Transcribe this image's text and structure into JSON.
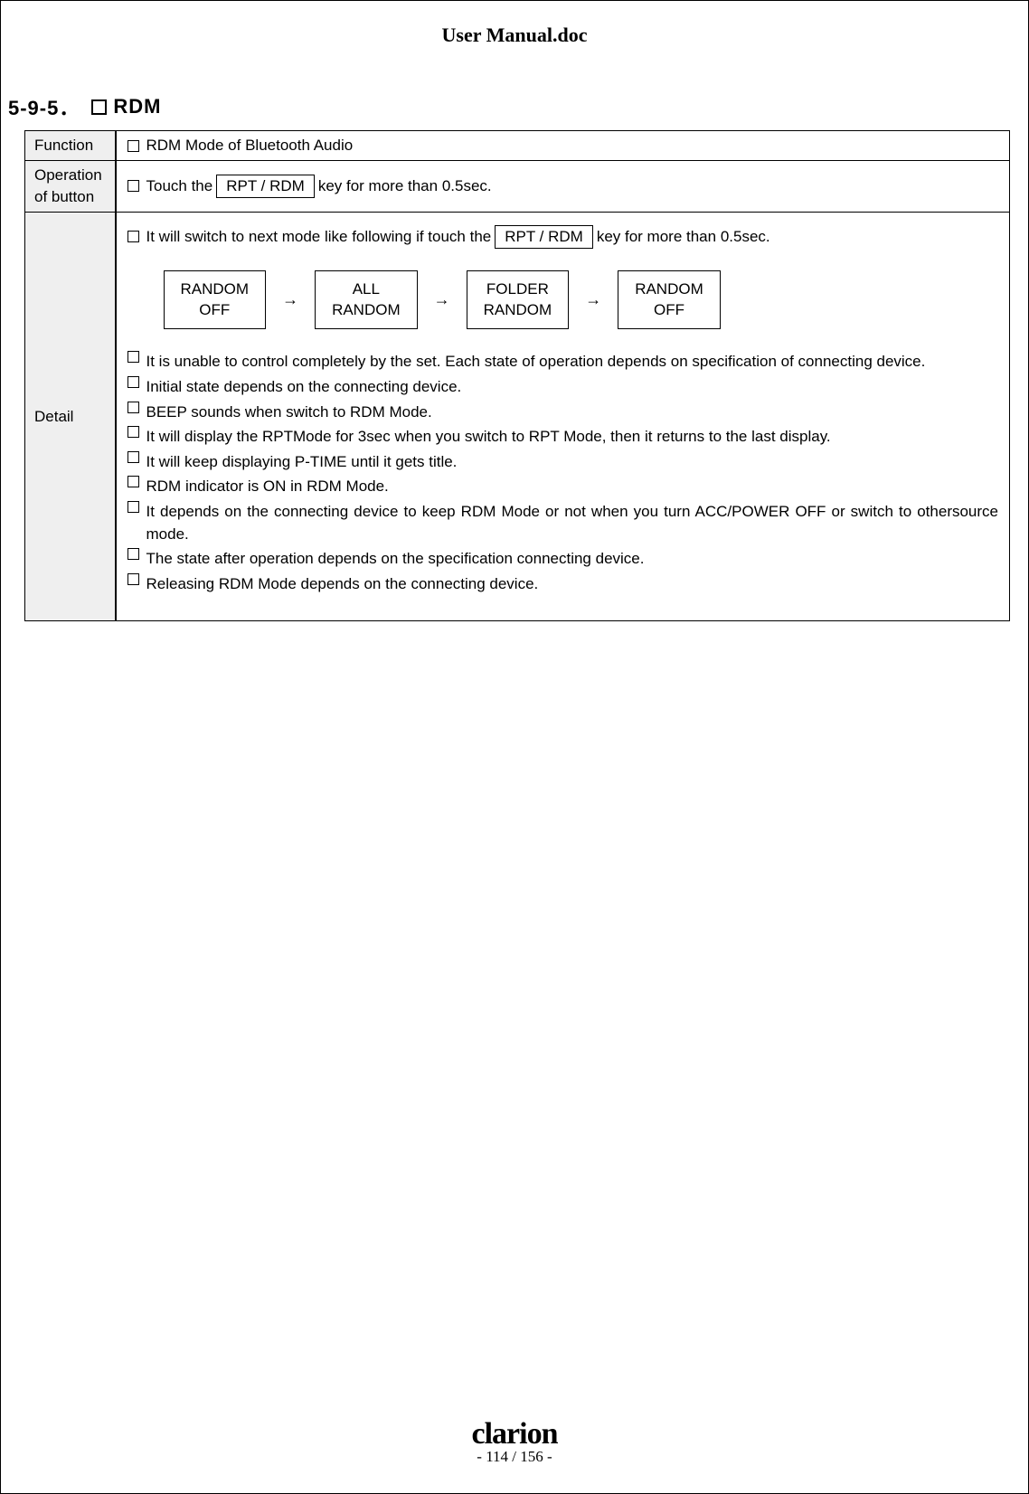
{
  "doc_title": "User Manual.doc",
  "section": {
    "number": "5-9-5．",
    "title": "RDM"
  },
  "rows": {
    "function": {
      "label": "Function",
      "text": "RDM Mode of Bluetooth Audio"
    },
    "operation": {
      "label": "Operation of button",
      "pre": "Touch the",
      "key": "RPT / RDM",
      "post": "key for more than 0.5sec."
    },
    "detail": {
      "label": "Detail",
      "intro_pre": "It will switch to next mode like following if touch the",
      "intro_key": "RPT / RDM",
      "intro_post": "key for more than 0.5sec.",
      "flow": [
        {
          "l1": "RANDOM",
          "l2": "OFF"
        },
        {
          "l1": "ALL",
          "l2": "RANDOM"
        },
        {
          "l1": "FOLDER",
          "l2": "RANDOM"
        },
        {
          "l1": "RANDOM",
          "l2": "OFF"
        }
      ],
      "bullets": [
        "It is unable to control completely by the set. Each state of operation depends on specification of connecting device.",
        "Initial state depends on the connecting device.",
        "BEEP sounds when switch to RDM Mode.",
        "It will display the RPTMode for 3sec when you switch to RPT Mode, then it returns to the last display.",
        "It will keep displaying P-TIME until it gets title.",
        "RDM indicator is ON in RDM Mode.",
        "It depends on the connecting device to keep RDM Mode or not when you turn ACC/POWER OFF or switch to othersource mode.",
        "The state after operation depends on the specification connecting device.",
        "Releasing RDM Mode depends on the connecting device."
      ]
    }
  },
  "footer": {
    "brand": "clarion",
    "page": "- 114 / 156 -"
  }
}
